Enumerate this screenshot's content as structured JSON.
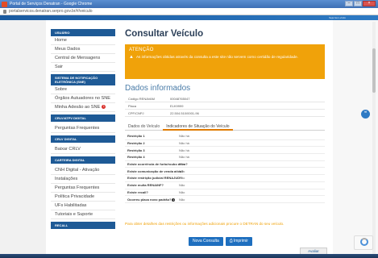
{
  "window": {
    "title": "Portal de Serviços Denatran - Google Chrome",
    "url": "portalservicos.denatran.serpro.gov.br/#/veiculo",
    "header_text": "Seja bem-vindo"
  },
  "sidebar": {
    "sections": [
      {
        "head": "USUÁRIO",
        "items": [
          "Home",
          "Meus Dados",
          "Central de Mensagens",
          "Sair"
        ]
      },
      {
        "head": "SISTEMA DE NOTIFICAÇÃO ELETRÔNICA (SNE)",
        "items": [
          "Sobre",
          "Órgãos Autuadores no SNE",
          "Minha Adesão ao SNE"
        ]
      },
      {
        "head": "CRLV/ATPV DIGITAL",
        "items": [
          "Perguntas Frequentes"
        ]
      },
      {
        "head": "CRLV DIGITAL",
        "items": [
          "Baixar CRLV"
        ]
      },
      {
        "head": "CARTEIRA DIGITAL",
        "items": [
          "CNH Digital - Ativação",
          "Instalações",
          "Perguntas Frequentes",
          "Política Privacidade",
          "UFs Habilitadas",
          "Tutoriais e Suporte"
        ]
      },
      {
        "head": "RECALL",
        "items": []
      }
    ],
    "sne_badge": "1"
  },
  "main": {
    "title": "Consultar Veículo",
    "alert": {
      "title": "ATENÇÃO",
      "message": "As informações obtidas através da consulta a este site não servem como certidão de regularidade."
    },
    "section_title": "Dados informados",
    "info": [
      {
        "key": "Código RENAVAM",
        "value": "00048765047"
      },
      {
        "key": "Placa",
        "value": "ELK9999"
      },
      {
        "key": "CPF/CNPJ",
        "value": "22.504.510/0001-96"
      }
    ],
    "tabs": [
      "Dados do Veículo",
      "Indicadores de Situação do Veículo"
    ],
    "restrictions": [
      {
        "key": "Restrição 1",
        "value": "Não há"
      },
      {
        "key": "Restrição 2",
        "value": "Não há"
      },
      {
        "key": "Restrição 3",
        "value": "Não há"
      },
      {
        "key": "Restrição 4",
        "value": "Não há"
      },
      {
        "key": "Existe ocorrência de furto/roubo ativo?",
        "value": "Não"
      },
      {
        "key": "Existe comunicação de venda ativa?",
        "value": "Não"
      },
      {
        "key": "Existe restrição judicial RENAJUD?",
        "value": "Não"
      },
      {
        "key": "Existe multa RENAINF?",
        "value": "Não"
      },
      {
        "key": "Existe recall?",
        "value": "Não"
      },
      {
        "key": "Ocorreu placa novo padrão?",
        "value": "Não"
      }
    ],
    "footnote": "Para obter detalhes das restrições ou informações adicionais procure o DETRAN do seu veículo.",
    "buttons": {
      "new": "Nova Consulta",
      "print": "Imprimir"
    }
  },
  "widgets": {
    "avaliar": "Avaliar"
  },
  "colors": {
    "accent": "#f0a20a",
    "brand": "#1e5a96",
    "title": "#2b3f58"
  }
}
